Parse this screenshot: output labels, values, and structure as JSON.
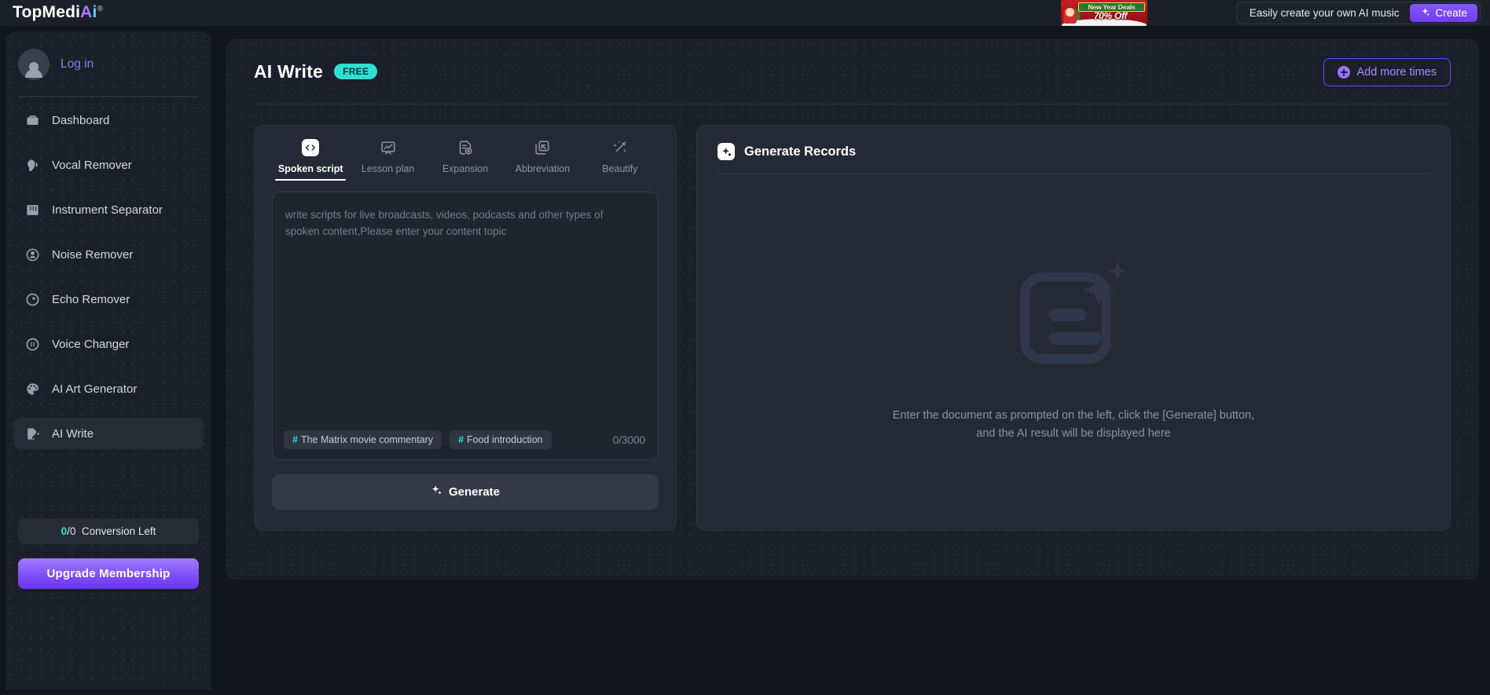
{
  "topbar": {
    "brand_main": "TopMedi",
    "brand_a": "A",
    "brand_i": "i",
    "brand_reg": "®",
    "promo_line1": "New Year Deals",
    "promo_line2": "70% Off",
    "music_text": "Easily create your own AI music",
    "create_label": "Create"
  },
  "sidebar": {
    "login_label": "Log in",
    "items": [
      {
        "label": "Dashboard",
        "icon": "briefcase-icon"
      },
      {
        "label": "Vocal Remover",
        "icon": "voice-head-icon"
      },
      {
        "label": "Instrument Separator",
        "icon": "piano-keys-icon"
      },
      {
        "label": "Noise Remover",
        "icon": "noise-waves-icon"
      },
      {
        "label": "Echo Remover",
        "icon": "echo-circle-icon"
      },
      {
        "label": "Voice Changer",
        "icon": "voice-changer-icon"
      },
      {
        "label": "AI Art Generator",
        "icon": "palette-icon"
      },
      {
        "label": "AI Write",
        "icon": "pencil-doc-icon"
      }
    ],
    "active_index": 7,
    "conversion_num": "0",
    "conversion_rest": "/0",
    "conversion_label": "Conversion Left",
    "upgrade_label": "Upgrade Membership"
  },
  "page": {
    "title": "AI Write",
    "badge": "FREE",
    "add_times_label": "Add more times"
  },
  "tabs": [
    {
      "label": "Spoken script",
      "icon": "code-file-icon",
      "active": true
    },
    {
      "label": "Lesson plan",
      "icon": "chart-board-icon",
      "active": false
    },
    {
      "label": "Expansion",
      "icon": "doc-plus-icon",
      "active": false
    },
    {
      "label": "Abbreviation",
      "icon": "collapse-doc-icon",
      "active": false
    },
    {
      "label": "Beautify",
      "icon": "magic-wand-icon",
      "active": false
    }
  ],
  "editor": {
    "placeholder": "write scripts for live broadcasts, videos, podcasts and other types of spoken content,Please enter your content topic",
    "value": "",
    "chips": [
      {
        "hash": "#",
        "label": "The Matrix movie commentary"
      },
      {
        "hash": "#",
        "label": "Food introduction"
      }
    ],
    "counter": "0/3000",
    "generate_label": "Generate"
  },
  "records": {
    "title": "Generate Records",
    "empty_line1": "Enter the document as prompted on the left, click the [Generate] button,",
    "empty_line2": "and the AI result will be displayed here"
  },
  "colors": {
    "accent_purple": "#7b4df5",
    "accent_cyan": "#2fe0d0",
    "panel_bg": "#242935",
    "page_bg": "#12151c",
    "surface": "#1b1f29"
  }
}
